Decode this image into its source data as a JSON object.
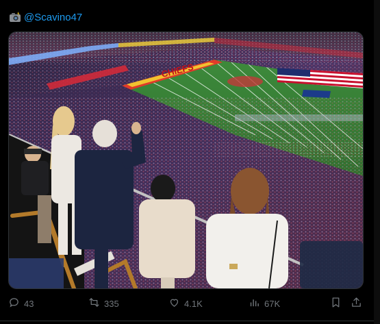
{
  "post": {
    "author_icon": "camera-with-flash-icon",
    "handle": "@Scavino47",
    "media": {
      "scene": "stadium-photo",
      "banner_text": "CHIEFS",
      "flag": "american-flag",
      "field_logo": "super-bowl-field-logo"
    }
  },
  "actions": {
    "replies": "43",
    "reposts": "335",
    "likes": "4.1K",
    "views": "67K"
  },
  "colors": {
    "accent": "#1d9bf0",
    "muted": "#71767b",
    "background": "#000000",
    "border": "#2f3336"
  }
}
